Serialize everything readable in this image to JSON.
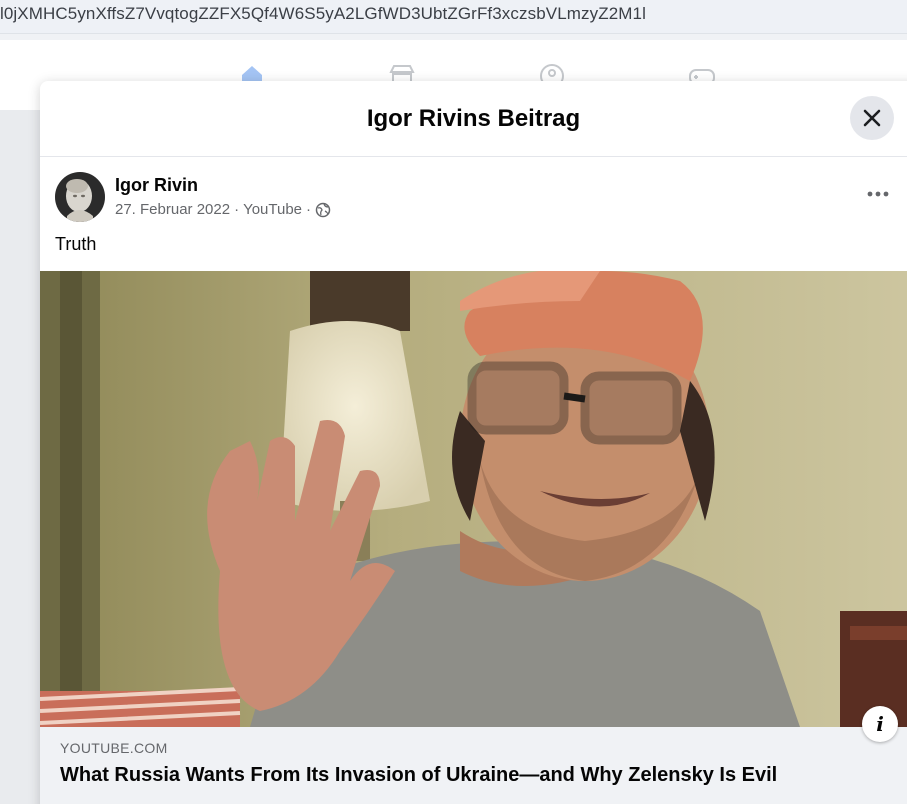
{
  "browser": {
    "url_fragment": "l0jXMHC5ynXffsZ7VvqtogZZFX5Qf4W6S5yA2LGfWD3UbtZGrFf3xczsbVLmzyZ2M1l"
  },
  "modal": {
    "title": "Igor Rivins Beitrag",
    "close_icon": "close-icon"
  },
  "post": {
    "author": "Igor Rivin",
    "date": "27. Februar 2022",
    "source": "YouTube",
    "separator": "·",
    "privacy_icon": "globe-icon",
    "more_icon": "more-options-icon",
    "text": "Truth"
  },
  "link_preview": {
    "domain": "YOUTUBE.COM",
    "title": "What Russia Wants From Its Invasion of Ukraine—and Why Zelensky Is Evil",
    "info_icon": "info-icon",
    "info_glyph": "i"
  },
  "nav": {
    "icons": [
      "home-icon",
      "marketplace-icon",
      "groups-icon",
      "gaming-icon"
    ]
  },
  "colors": {
    "accent": "#1877f2",
    "text_primary": "#050505",
    "text_secondary": "#65676b",
    "card_bg": "#f0f2f5"
  }
}
